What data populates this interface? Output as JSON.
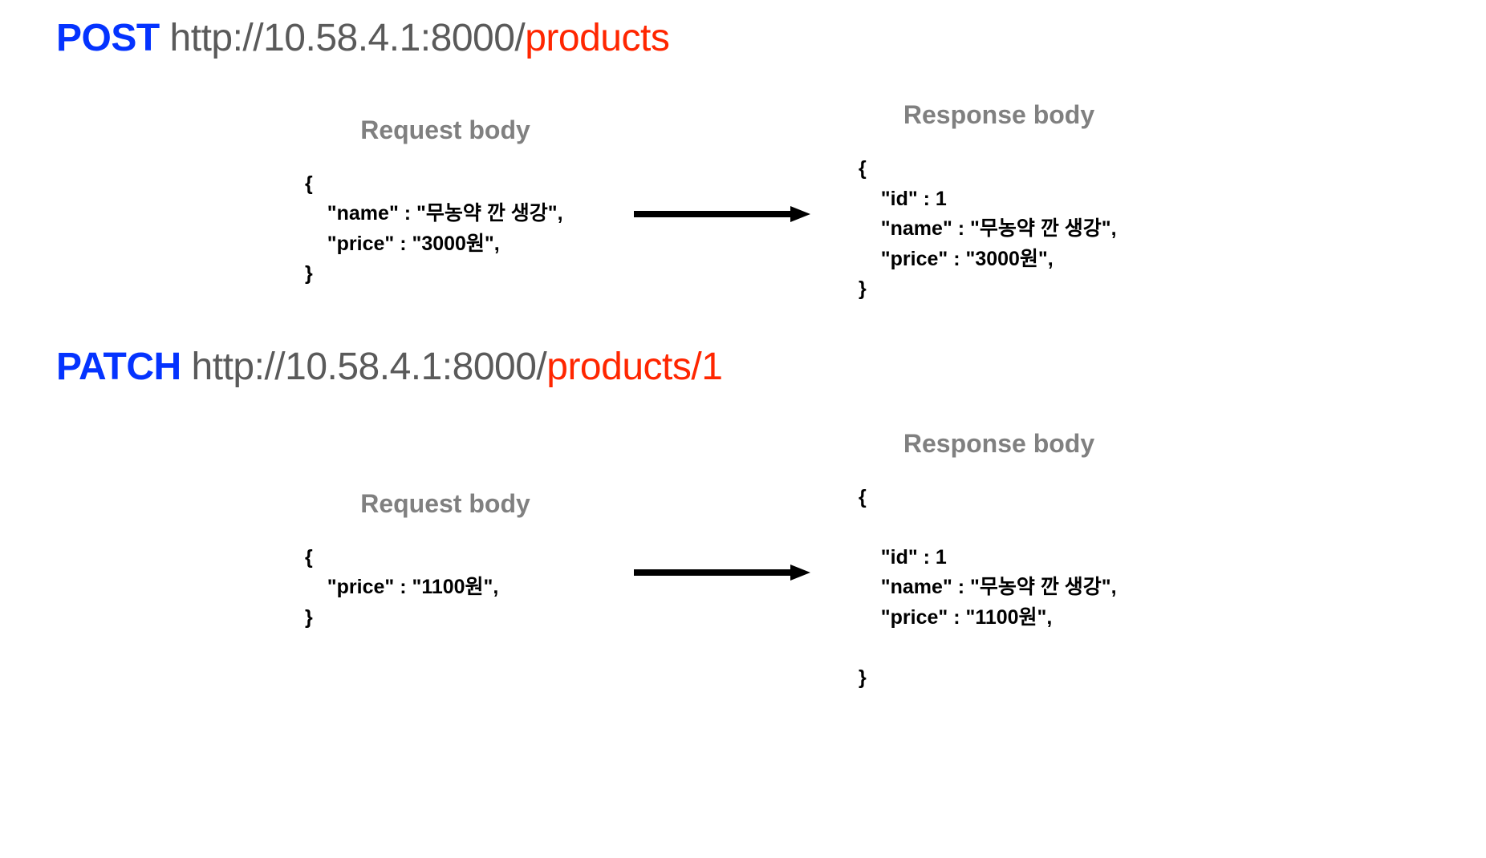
{
  "post": {
    "method": "POST",
    "url_prefix": "http://10.58.4.1:8000/",
    "url_path": "products",
    "request_title": "Request body",
    "response_title": "Response body",
    "request_body": "{\n    \"name\" : \"무농약 깐 생강\",\n    \"price\" : \"3000원\",\n}",
    "response_body": "{\n    \"id\" : 1\n    \"name\" : \"무농약 깐 생강\",\n    \"price\" : \"3000원\",\n}"
  },
  "patch": {
    "method": "PATCH",
    "url_prefix": "http://10.58.4.1:8000/",
    "url_path": "products/1",
    "request_title": "Request body",
    "response_title": "Response body",
    "request_body": "{\n    \"price\" : \"1100원\",\n}",
    "response_body": "{\n\n    \"id\" : 1\n    \"name\" : \"무농약 깐 생강\",\n    \"price\" : \"1100원\",\n\n}"
  }
}
